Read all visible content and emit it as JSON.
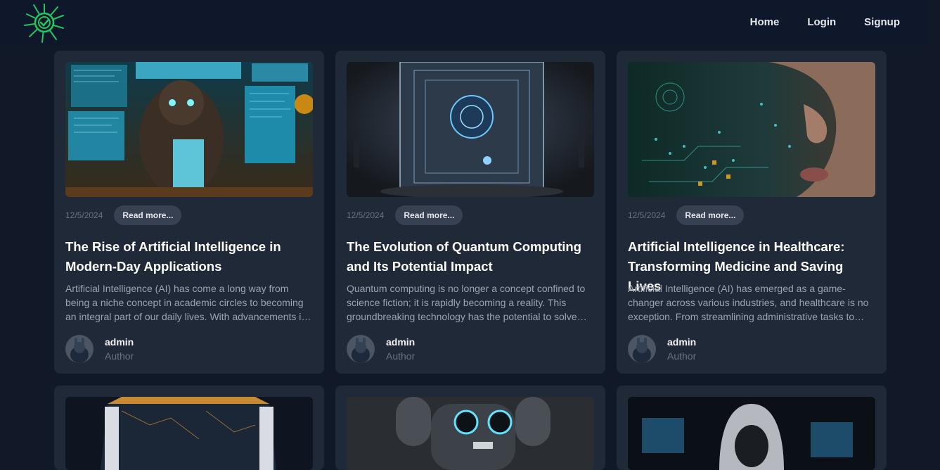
{
  "nav": {
    "logo_icon": "sun-check-logo-icon",
    "links": [
      "Home",
      "Login",
      "Signup"
    ]
  },
  "colors": {
    "background": "#111827",
    "navbar": "#0f172a",
    "card": "#1f2937",
    "logo_green": "#22c55e"
  },
  "posts": [
    {
      "image": "ai-hacker-robot-image",
      "date": "12/5/2024",
      "read_more": "Read more...",
      "title": "The Rise of Artificial Intelligence in Modern-Day Applications",
      "excerpt": "Artificial Intelligence (AI) has come a long way from being a niche concept in academic circles to becoming an integral part of our daily lives. With advancements in technology, AI is now transforming industries.",
      "author": "admin",
      "role": "Author"
    },
    {
      "image": "quantum-computer-image",
      "date": "12/5/2024",
      "read_more": "Read more...",
      "title": "The Evolution of Quantum Computing and Its Potential Impact",
      "excerpt": "Quantum computing is no longer a concept confined to science fiction; it is rapidly becoming a reality. This groundbreaking technology has the potential to solve problems beyond the reach of classical computers.",
      "author": "admin",
      "role": "Author"
    },
    {
      "image": "ai-healthcare-face-image",
      "date": "12/5/2024",
      "read_more": "Read more...",
      "title": "Artificial Intelligence in Healthcare: Transforming Medicine and Saving Lives",
      "excerpt": "Artificial Intelligence (AI) has emerged as a game-changer across various industries, and healthcare is no exception. From streamlining administrative tasks to diagnosing diseases.",
      "author": "admin",
      "role": "Author"
    },
    {
      "image": "circuit-cube-image"
    },
    {
      "image": "robot-headphones-image"
    },
    {
      "image": "hooded-hacker-image"
    }
  ]
}
